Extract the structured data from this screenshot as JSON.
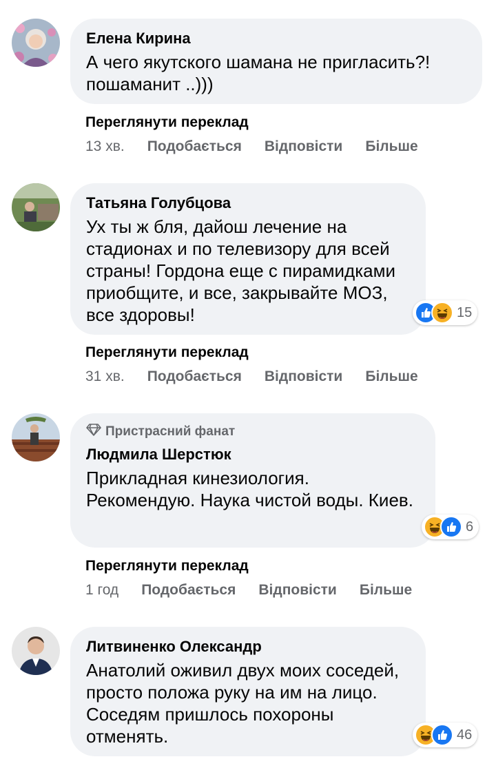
{
  "comments": [
    {
      "author": "Елена Кирина",
      "text": "А чего якутского шамана не пригласить?! пошаманит ..)))",
      "translate": "Переглянути переклад",
      "time": "13 хв.",
      "like": "Подобається",
      "reply": "Відповісти",
      "more": "Більше"
    },
    {
      "author": "Татьяна Голубцова",
      "text": "Ух ты ж бля, дайош лечение на стадионах и по телевизору для всей страны! Гордона еще с пирамидками приобщите, и все, закрывайте МОЗ, все здоровы!",
      "reactions_count": "15",
      "translate": "Переглянути переклад",
      "time": "31 хв.",
      "like": "Подобається",
      "reply": "Відповісти",
      "more": "Більше"
    },
    {
      "badge": "Пристрасний фанат",
      "author": "Людмила Шерстюк",
      "text": "Прикладная кинезиология. Рекомендую. Наука чистой воды. Киев.",
      "reactions_count": "6",
      "translate": "Переглянути переклад",
      "time": "1 год",
      "like": "Подобається",
      "reply": "Відповісти",
      "more": "Більше"
    },
    {
      "author": "Литвиненко Олександр",
      "text": "Анатолий оживил двух моих соседей, просто положа руку на им на лицо. Соседям пришлось похороны отменять.",
      "reactions_count": "46"
    }
  ],
  "colors": {
    "bubble": "#f0f2f5",
    "secondary_text": "#65676b",
    "like_blue": "#1877f2",
    "haha_yellow": "#f7b125"
  },
  "icons": [
    "like-reaction-icon",
    "haha-reaction-icon",
    "diamond-badge-icon"
  ]
}
